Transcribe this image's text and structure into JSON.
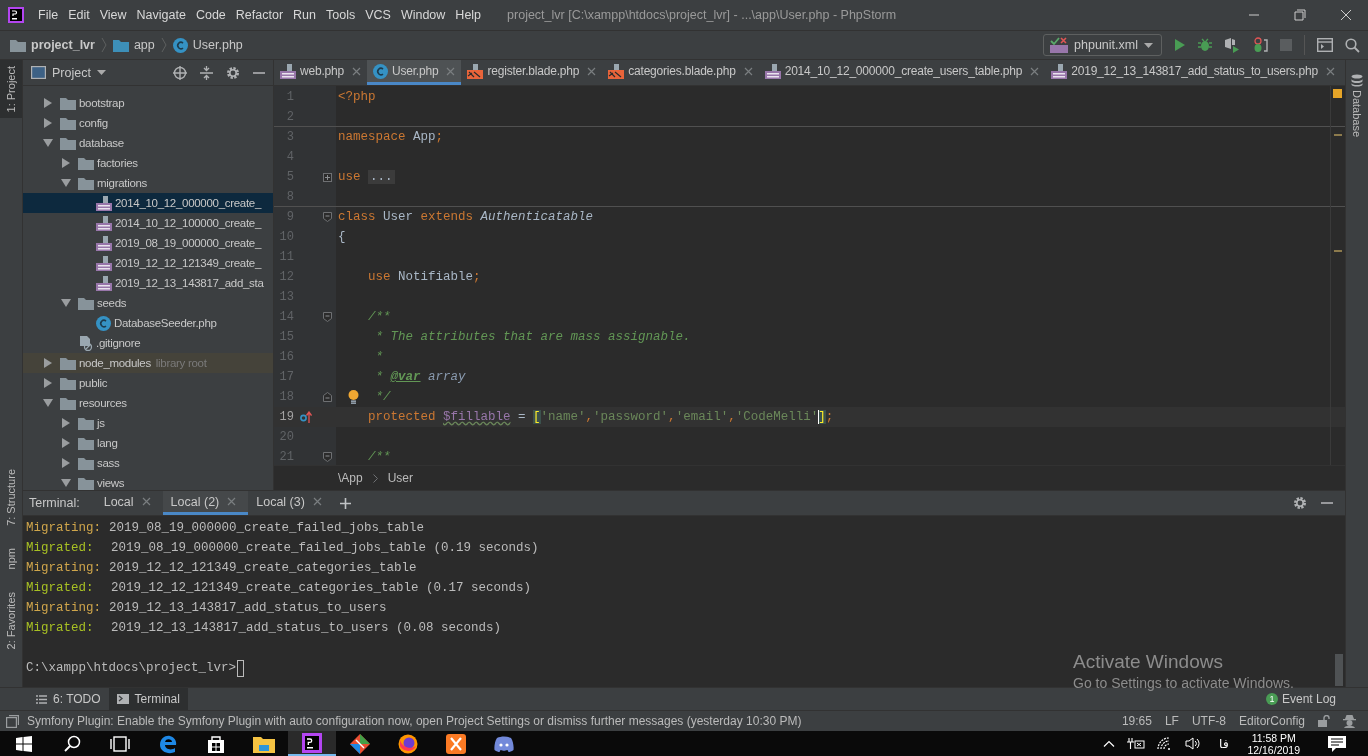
{
  "window": {
    "title": "project_lvr [C:\\xampp\\htdocs\\project_lvr] - ...\\app\\User.php - PhpStorm"
  },
  "menu": [
    "File",
    "Edit",
    "View",
    "Navigate",
    "Code",
    "Refactor",
    "Run",
    "Tools",
    "VCS",
    "Window",
    "Help"
  ],
  "nav_bar": [
    {
      "label": "project_lvr",
      "kind": "project"
    },
    {
      "label": "app",
      "kind": "folder"
    },
    {
      "label": "User.php",
      "kind": "class"
    }
  ],
  "run_config": {
    "label": "phpunit.xml"
  },
  "left_stripe": [
    {
      "label": "1: Project",
      "selected": true
    },
    {
      "label": "7: Structure",
      "selected": false
    },
    {
      "label": "npm",
      "selected": false
    },
    {
      "label": "2: Favorites",
      "selected": false
    }
  ],
  "right_stripe": [
    {
      "label": "Database"
    }
  ],
  "project_panel": {
    "title": "Project",
    "tree": [
      {
        "label": "bootstrap",
        "kind": "folder",
        "expanded": false,
        "selected": false
      },
      {
        "label": "config",
        "kind": "folder",
        "expanded": false,
        "selected": false
      },
      {
        "label": "database",
        "kind": "folder",
        "expanded": true,
        "selected": false,
        "children": [
          {
            "label": "factories",
            "kind": "folder",
            "expanded": false,
            "selected": false
          },
          {
            "label": "migrations",
            "kind": "folder",
            "expanded": true,
            "selected": false,
            "children": [
              {
                "label": "2014_10_12_000000_create_",
                "kind": "php",
                "selected": true
              },
              {
                "label": "2014_10_12_100000_create_",
                "kind": "php",
                "selected": false
              },
              {
                "label": "2019_08_19_000000_create_",
                "kind": "php",
                "selected": false
              },
              {
                "label": "2019_12_12_121349_create_",
                "kind": "php",
                "selected": false
              },
              {
                "label": "2019_12_13_143817_add_sta",
                "kind": "php",
                "selected": false
              }
            ]
          },
          {
            "label": "seeds",
            "kind": "folder",
            "expanded": true,
            "selected": false,
            "children": [
              {
                "label": "DatabaseSeeder.php",
                "kind": "class",
                "selected": false
              }
            ]
          },
          {
            "label": ".gitignore",
            "kind": "ignore",
            "selected": false
          }
        ]
      },
      {
        "label": "node_modules",
        "hint": "library root",
        "kind": "folder",
        "expanded": false,
        "selected": false
      },
      {
        "label": "public",
        "kind": "folder",
        "expanded": false,
        "selected": false
      },
      {
        "label": "resources",
        "kind": "folder",
        "expanded": true,
        "selected": false,
        "children": [
          {
            "label": "js",
            "kind": "folder",
            "expanded": false,
            "selected": false
          },
          {
            "label": "lang",
            "kind": "folder",
            "expanded": false,
            "selected": false
          },
          {
            "label": "sass",
            "kind": "folder",
            "expanded": false,
            "selected": false
          },
          {
            "label": "views",
            "kind": "folder",
            "expanded": true,
            "selected": false
          }
        ]
      }
    ]
  },
  "editor_tabs": [
    {
      "label": "web.php",
      "kind": "php",
      "selected": false
    },
    {
      "label": "User.php",
      "kind": "class",
      "selected": true
    },
    {
      "label": "register.blade.php",
      "kind": "blade",
      "selected": false
    },
    {
      "label": "categories.blade.php",
      "kind": "blade",
      "selected": false
    },
    {
      "label": "2014_10_12_000000_create_users_table.php",
      "kind": "php",
      "selected": false
    },
    {
      "label": "2019_12_13_143817_add_status_to_users.php",
      "kind": "php",
      "selected": false
    }
  ],
  "code_lines": [
    {
      "number": "1",
      "tokens": [
        {
          "kind": "kw",
          "text": "<?php"
        }
      ]
    },
    {
      "number": "2",
      "separator": true
    },
    {
      "number": "3",
      "tokens": [
        {
          "kind": "kw",
          "text": "namespace "
        },
        {
          "kind": "id",
          "text": "App"
        },
        {
          "kind": "kw",
          "text": ";"
        }
      ]
    },
    {
      "number": "4"
    },
    {
      "number": "5",
      "fold": {
        "kind": "collapsed"
      },
      "tokens": [
        {
          "kind": "kw",
          "text": "use "
        },
        {
          "kind": "folded",
          "text": "..."
        }
      ]
    },
    {
      "number": "8",
      "separator": true
    },
    {
      "number": "9",
      "fold": {
        "kind": "start"
      },
      "tokens": [
        {
          "kind": "kw",
          "text": "class "
        },
        {
          "kind": "id",
          "text": "User "
        },
        {
          "kind": "kw",
          "text": "extends "
        },
        {
          "kind": "type",
          "text": "Authenticatable"
        }
      ]
    },
    {
      "number": "10",
      "tokens": [
        {
          "kind": "id",
          "text": "{"
        }
      ]
    },
    {
      "number": "11"
    },
    {
      "number": "12",
      "tokens": [
        {
          "kind": "kw",
          "text": "    use "
        },
        {
          "kind": "id",
          "text": "Notifiable"
        },
        {
          "kind": "kw",
          "text": ";"
        }
      ]
    },
    {
      "number": "13"
    },
    {
      "number": "14",
      "fold": {
        "kind": "start"
      },
      "tokens": [
        {
          "kind": "comment",
          "text": "    /**"
        }
      ]
    },
    {
      "number": "15",
      "tokens": [
        {
          "kind": "comment",
          "text": "     * The attributes that are mass assignable."
        }
      ]
    },
    {
      "number": "16",
      "tokens": [
        {
          "kind": "comment",
          "text": "     *"
        }
      ]
    },
    {
      "number": "17",
      "tokens": [
        {
          "kind": "comment",
          "text": "     * "
        },
        {
          "kind": "doctag",
          "text": "@var"
        },
        {
          "kind": "docword",
          "text": " array"
        }
      ]
    },
    {
      "number": "18",
      "fold": {
        "kind": "end"
      },
      "intention": true,
      "tokens": [
        {
          "kind": "comment",
          "text": "     */"
        }
      ]
    },
    {
      "number": "19",
      "current": true,
      "gutter_icon": {
        "kind": "override"
      },
      "tokens": [
        {
          "kind": "kw",
          "text": "    protected "
        },
        {
          "kind": "var",
          "text": "$fillable"
        },
        {
          "kind": "id",
          "text": " = "
        },
        {
          "kind": "bracket",
          "text": "["
        },
        {
          "kind": "str",
          "text": "'name'"
        },
        {
          "kind": "kw",
          "text": ","
        },
        {
          "kind": "str",
          "text": "'password'"
        },
        {
          "kind": "kw",
          "text": ","
        },
        {
          "kind": "str",
          "text": "'email'"
        },
        {
          "kind": "kw",
          "text": ","
        },
        {
          "kind": "str",
          "text": "'CodeMelli'"
        },
        {
          "kind": "caretbracket",
          "text": "]"
        },
        {
          "kind": "kw",
          "text": ";"
        }
      ]
    },
    {
      "number": "20"
    },
    {
      "number": "21",
      "fold": {
        "kind": "start"
      },
      "tokens": [
        {
          "kind": "comment",
          "text": "    /**"
        }
      ]
    }
  ],
  "editor_breadcrumbs": [
    "\\App",
    "User"
  ],
  "terminal": {
    "title": "Terminal:",
    "tabs": [
      {
        "label": "Local",
        "selected": false
      },
      {
        "label": "Local (2)",
        "selected": true
      },
      {
        "label": "Local (3)",
        "selected": false
      }
    ],
    "lines": [
      {
        "kind": "migrating",
        "status": "Migrating:",
        "text": "2019_08_19_000000_create_failed_jobs_table"
      },
      {
        "kind": "migrated",
        "status": "Migrated:",
        "text": "2019_08_19_000000_create_failed_jobs_table (0.19 seconds)"
      },
      {
        "kind": "migrating",
        "status": "Migrating:",
        "text": "2019_12_12_121349_create_categories_table"
      },
      {
        "kind": "migrated",
        "status": "Migrated:",
        "text": "2019_12_12_121349_create_categories_table (0.17 seconds)"
      },
      {
        "kind": "migrating",
        "status": "Migrating:",
        "text": "2019_12_13_143817_add_status_to_users"
      },
      {
        "kind": "migrated",
        "status": "Migrated:",
        "text": "2019_12_13_143817_add_status_to_users (0.08 seconds)"
      }
    ],
    "prompt": "C:\\xampp\\htdocs\\project_lvr>"
  },
  "activation_notice": {
    "title": "Activate Windows",
    "text": "Go to Settings to activate Windows."
  },
  "tool_tabs": [
    {
      "label": "6: TODO",
      "kind": "todo",
      "selected": false
    },
    {
      "label": "Terminal",
      "kind": "terminal",
      "selected": true
    }
  ],
  "event_log": {
    "count": "1",
    "label": "Event Log"
  },
  "status_bar": {
    "message": "Symfony Plugin: Enable the Symfony Plugin with auto configuration now, open Project Settings or dismiss further messages (yesterday 10:30 PM)",
    "position": "19:65",
    "line_separator": "LF",
    "encoding": "UTF-8",
    "editor_config": "EditorConfig"
  },
  "taskbar": {
    "apps": [
      {
        "kind": "search",
        "selected": false
      },
      {
        "kind": "taskview",
        "selected": false
      },
      {
        "kind": "edge",
        "selected": false
      },
      {
        "kind": "store",
        "selected": false
      },
      {
        "kind": "explorer",
        "selected": false
      },
      {
        "kind": "phpstorm",
        "selected": true
      },
      {
        "kind": "git",
        "selected": false
      },
      {
        "kind": "firefox",
        "selected": false
      },
      {
        "kind": "xampp",
        "selected": false
      },
      {
        "kind": "discord",
        "selected": false
      }
    ],
    "language": "فا",
    "time": "11:58 PM",
    "date": "12/16/2019"
  }
}
